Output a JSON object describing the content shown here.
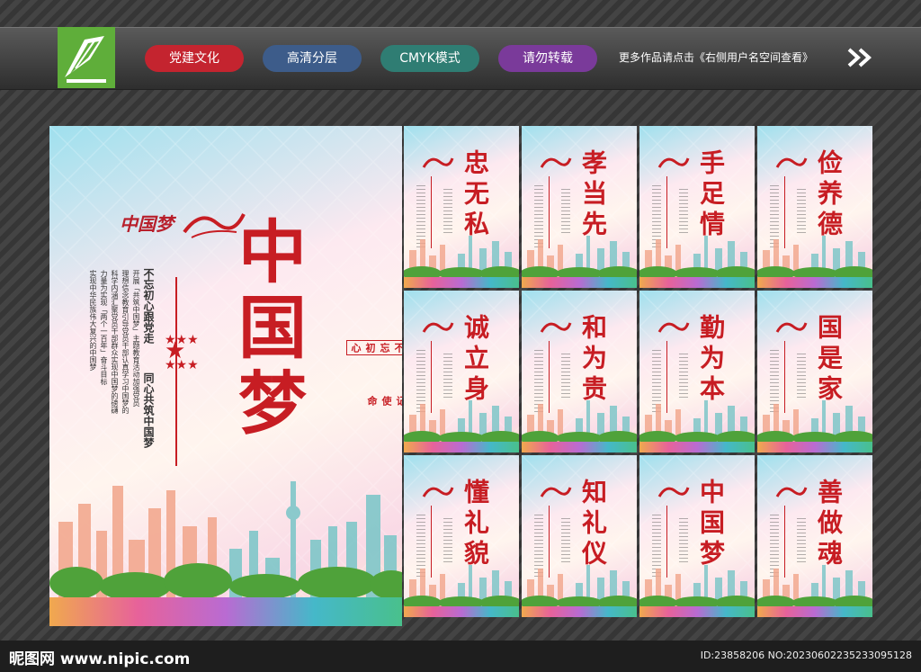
{
  "header": {
    "tags": [
      {
        "label": "党建文化",
        "color": "#c4242f"
      },
      {
        "label": "高清分层",
        "color": "#3d5c8a"
      },
      {
        "label": "CMYK模式",
        "color": "#2f7d73"
      },
      {
        "label": "请勿转载",
        "color": "#7a3a9a"
      }
    ],
    "more_text": "更多作品请点击《右侧用户名空间查看》"
  },
  "main_poster": {
    "logo_text": "中国梦",
    "title": "中国梦",
    "slogan_left": "不忘初心跟党走",
    "slogan_right": "同心共筑中国梦",
    "seal_1": "不忘初心",
    "seal_2": "牢记使命",
    "body_lines": [
      "开展「共筑中国梦」主题教育活动加强党员",
      "理想信念教育引导党员干部认真学习中国梦的",
      "科学内涵汇聚党员干部群众实现中国梦的磅礴",
      "力量为实现「两个一百年」奋斗目标",
      "实现中华民族伟大复兴的中国梦"
    ]
  },
  "small_posters": [
    {
      "title": "忠无私"
    },
    {
      "title": "孝当先"
    },
    {
      "title": "手足情"
    },
    {
      "title": "俭养德"
    },
    {
      "title": "诚立身"
    },
    {
      "title": "和为贵"
    },
    {
      "title": "勤为本"
    },
    {
      "title": "国是家"
    },
    {
      "title": "懂礼貌"
    },
    {
      "title": "知礼仪"
    },
    {
      "title": "中国梦"
    },
    {
      "title": "善做魂"
    }
  ],
  "footer": {
    "watermark": "昵图网 www.nipic.com",
    "id_text": "ID:23858206 NO:20230602235233095128"
  }
}
